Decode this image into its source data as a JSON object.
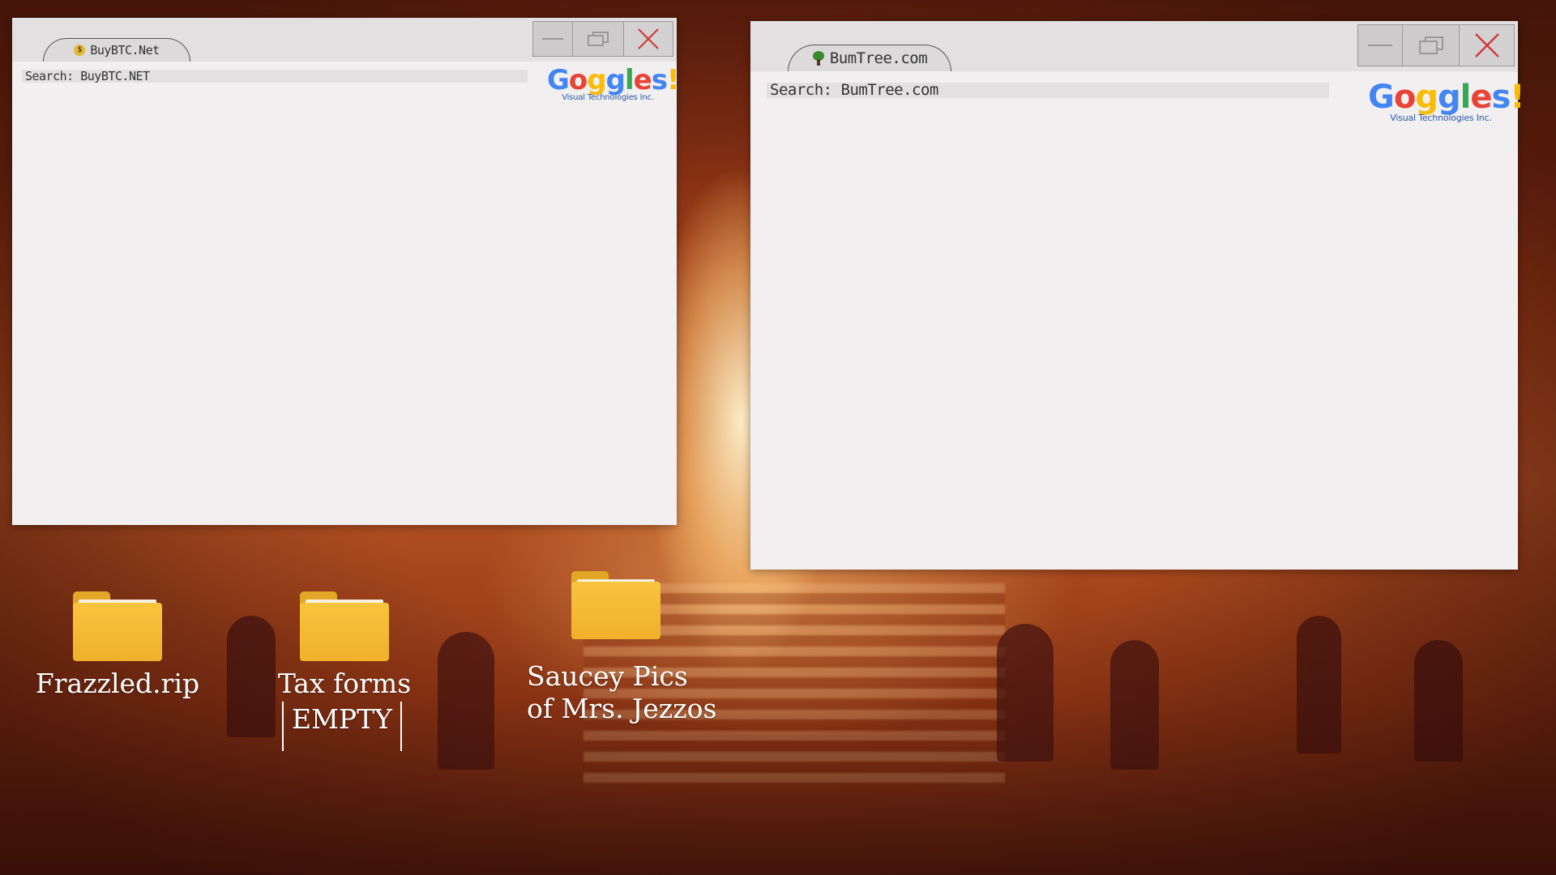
{
  "desktop": {
    "icons": [
      {
        "label": "Frazzled.rip",
        "icon": "folder-icon"
      },
      {
        "label": "Tax forms",
        "sublabel": "EMPTY",
        "icon": "folder-icon"
      },
      {
        "label_line1": "Saucey Pics",
        "label_line2": "of Mrs. Jezzos",
        "icon": "folder-icon"
      }
    ]
  },
  "windows": [
    {
      "tab_title": "BuyBTC.Net",
      "tab_icon": "dollar-coin-icon",
      "search_text": "Search: BuyBTC.NET",
      "logo": {
        "word": "Goggles!",
        "sub": "Visual Technologies Inc."
      }
    },
    {
      "tab_title": "BumTree.com",
      "tab_icon": "tree-icon",
      "search_text": "Search: BumTree.com",
      "logo": {
        "word": "Goggles!",
        "sub": "Visual Technologies Inc."
      }
    }
  ],
  "colors": {
    "close_x": "#d23a3a",
    "logo_letters": [
      "#4285f4",
      "#ea4335",
      "#fbbc05",
      "#4285f4",
      "#34a853",
      "#ea4335",
      "#4285f4",
      "#fbbc05"
    ]
  }
}
